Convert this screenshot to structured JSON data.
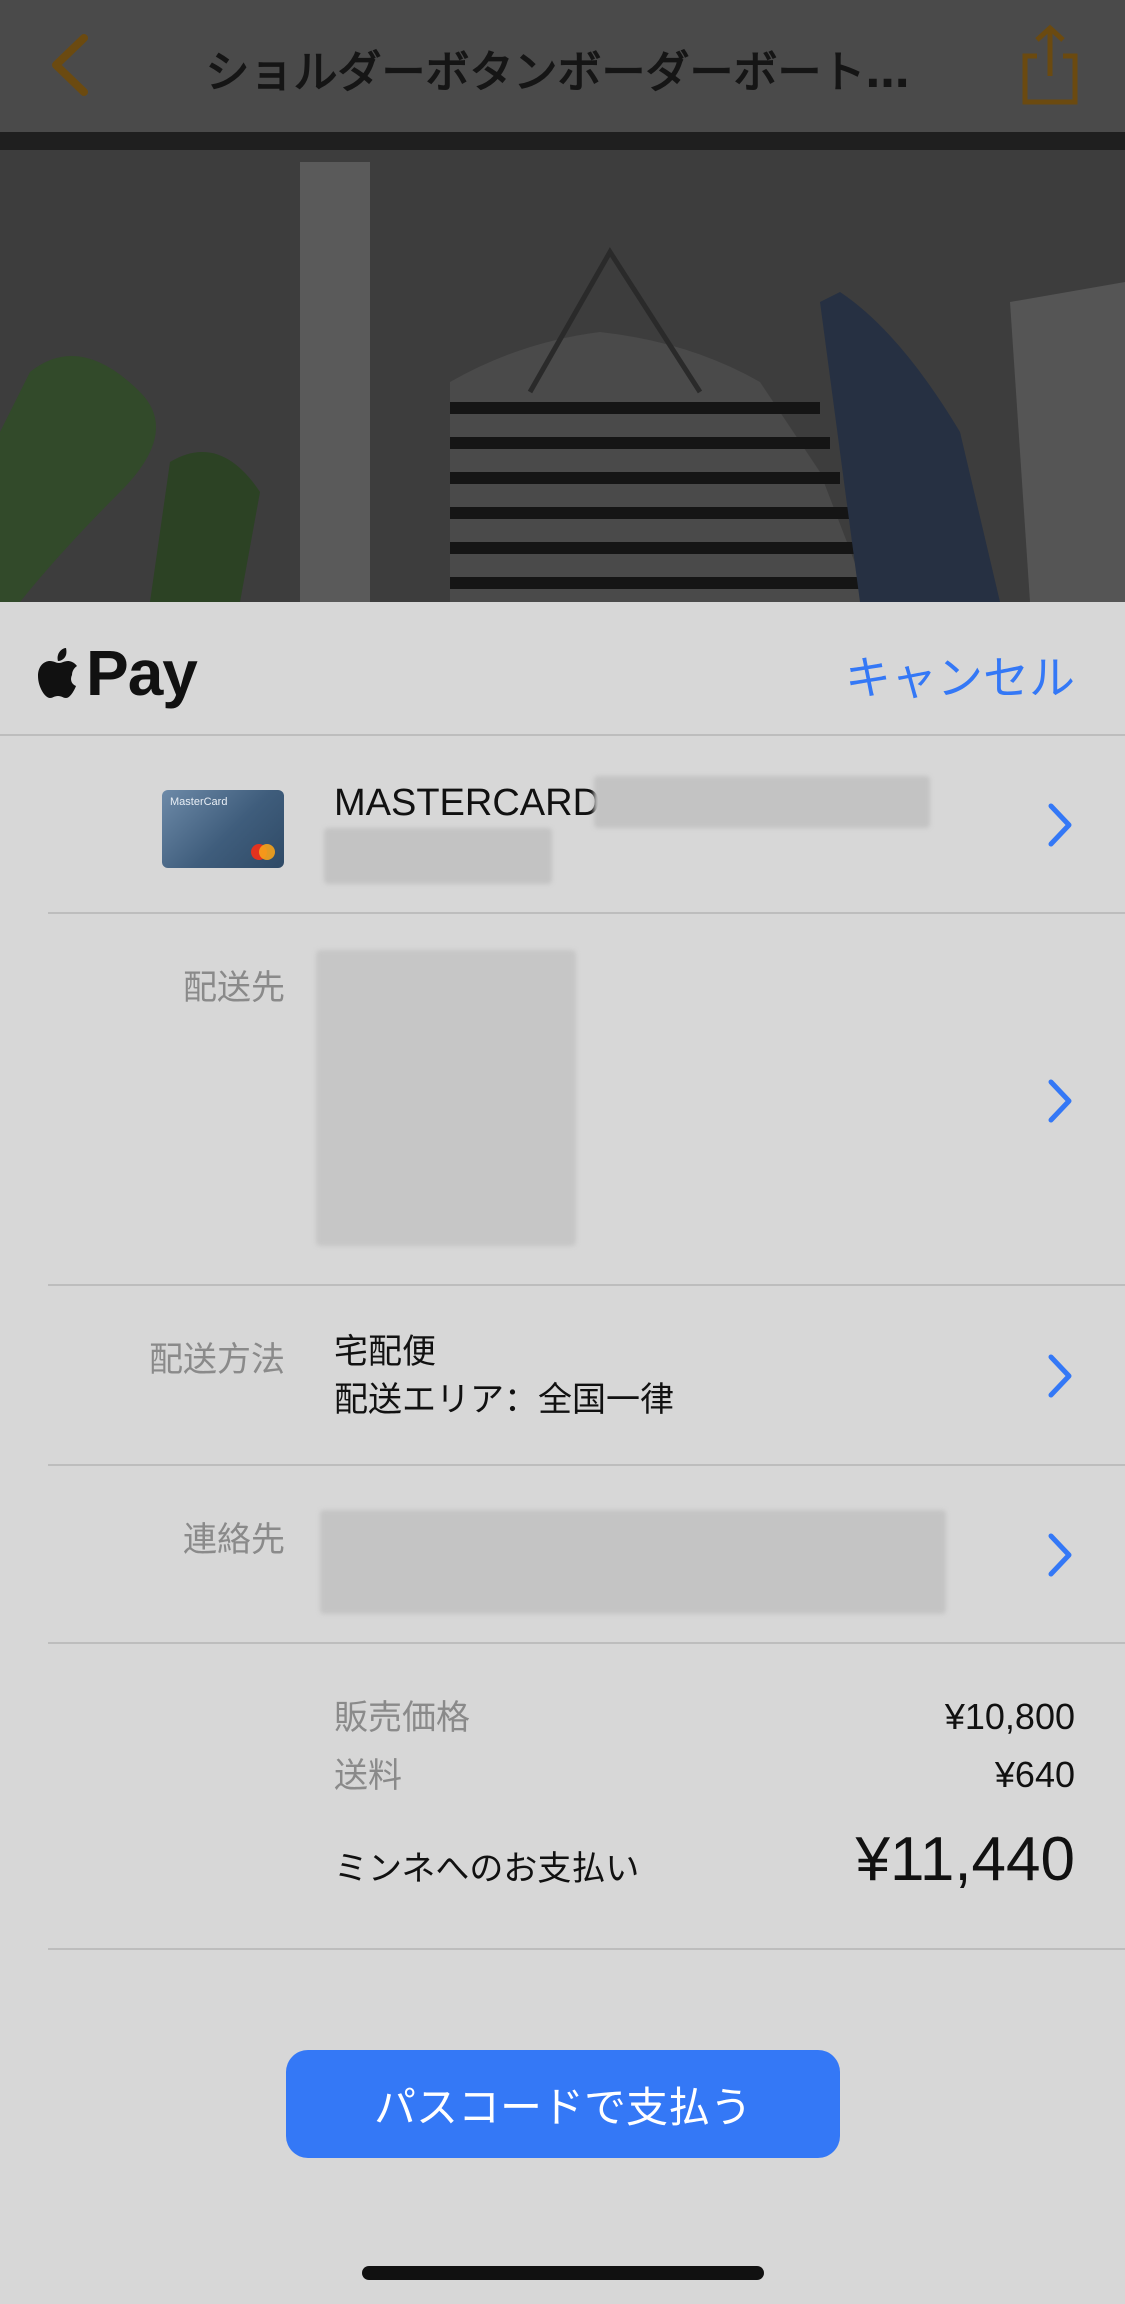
{
  "appbar": {
    "title": "ショルダーボタンボーダーボート…",
    "back_icon": "chevron-left-icon",
    "share_icon": "share-icon",
    "accent": "#b07a1a"
  },
  "sheet": {
    "brand": "Pay",
    "brand_icon": "apple-icon",
    "cancel": "キャンセル",
    "card": {
      "name": "MASTERCARD",
      "image_label": "MasterCard"
    },
    "shipping_address": {
      "label": "配送先"
    },
    "shipping_method": {
      "label": "配送方法",
      "line1": "宅配便",
      "line2": "配送エリア：全国一律"
    },
    "contact": {
      "label": "連絡先"
    },
    "summary": {
      "price_label": "販売価格",
      "price_value": "¥10,800",
      "shipping_label": "送料",
      "shipping_value": "¥640",
      "total_label": "ミンネへのお支払い",
      "total_value": "¥11,440"
    },
    "pay_button": "パスコードで支払う"
  },
  "colors": {
    "accent_blue": "#3478f6",
    "label_gray": "#8a8a8a",
    "sheet_bg": "#d7d7d7"
  }
}
